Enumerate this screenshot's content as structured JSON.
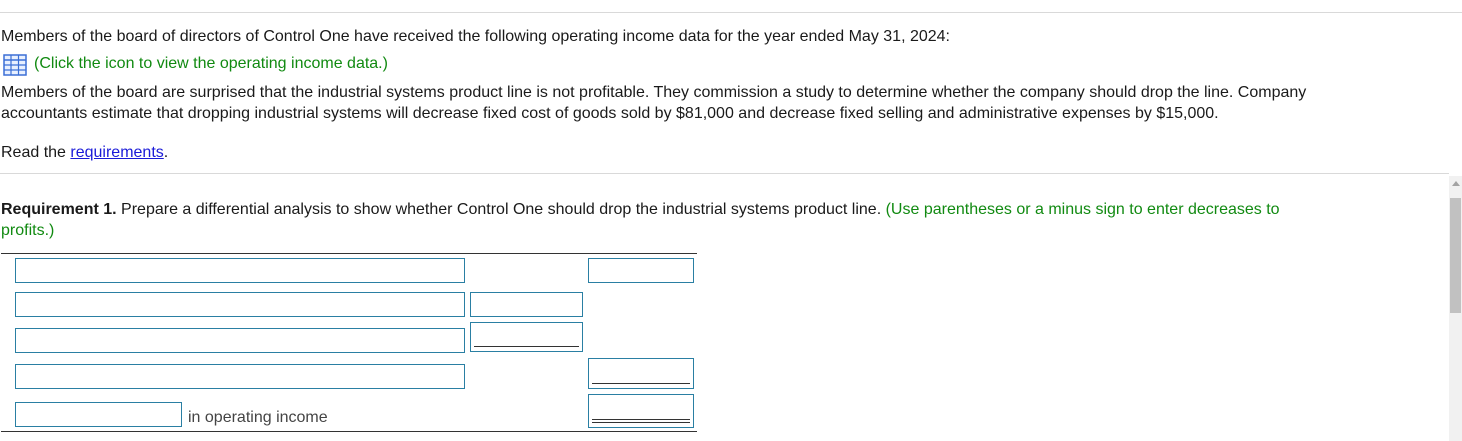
{
  "intro": {
    "line1": "Members of the board of directors of Control One have received the following operating income data for the year ended May 31, 2024:",
    "click_text": "(Click the icon to view the operating income data.)",
    "line2": "Members of the board are surprised that the industrial systems product line is not profitable. They commission a study to determine whether the company should drop the line. Company",
    "line3": "accountants estimate that dropping industrial systems will decrease fixed cost of goods sold by $81,000 and decrease fixed selling and administrative expenses by $15,000.",
    "read_prefix": "Read the ",
    "read_link": "requirements",
    "read_suffix": "."
  },
  "requirement": {
    "label": "Requirement 1.",
    "text": " Prepare a differential analysis to show whether Control One should drop the industrial systems product line. ",
    "hint_line1": "(Use parentheses or a minus sign to enter decreases to",
    "hint_line2": "profits.)"
  },
  "table": {
    "last_row_label": "in operating income",
    "rows": [
      {
        "label_value": "",
        "mid_value": null,
        "right_value": ""
      },
      {
        "label_value": "",
        "mid_value": "",
        "right_value": null
      },
      {
        "label_value": "",
        "mid_value": "",
        "right_value": null
      },
      {
        "label_value": "",
        "mid_value": null,
        "right_value": ""
      },
      {
        "label_value": "",
        "mid_value": null,
        "right_value": ""
      }
    ]
  },
  "icons": {
    "data_icon": "spreadsheet-icon"
  },
  "colors": {
    "hint_green": "#118a11",
    "link_blue": "#1a1ad8",
    "input_border": "#2a7fa3",
    "grid_icon_blue": "#3b6fd6"
  }
}
